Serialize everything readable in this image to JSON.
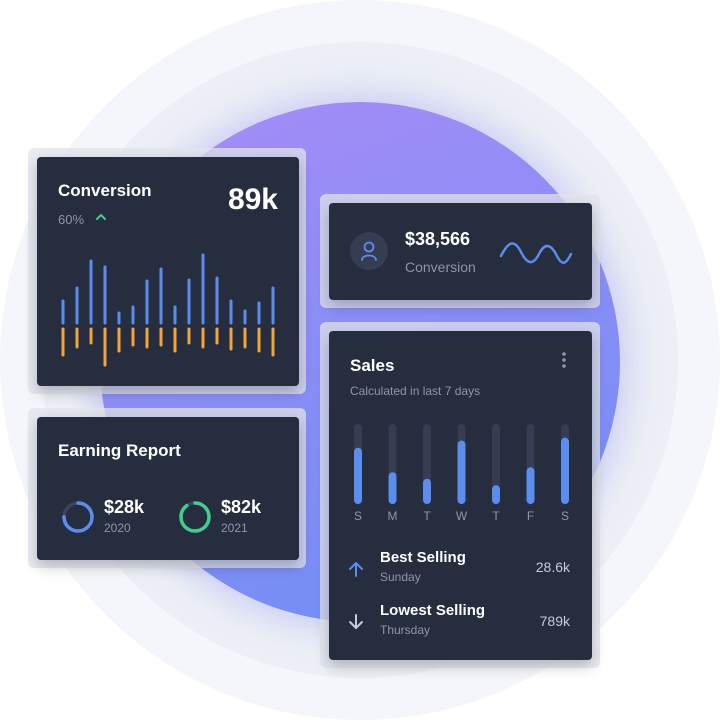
{
  "conversion_card": {
    "title": "Conversion",
    "value": "89k",
    "percent": "60%",
    "trend_icon": "chevron-up-icon",
    "colors": {
      "up": "#5b8def",
      "down": "#f3a43b",
      "trend": "#3fcf8e"
    },
    "bars": [
      {
        "up": 22,
        "down": 26
      },
      {
        "up": 35,
        "down": 18
      },
      {
        "up": 62,
        "down": 14
      },
      {
        "up": 56,
        "down": 36
      },
      {
        "up": 10,
        "down": 22
      },
      {
        "up": 16,
        "down": 16
      },
      {
        "up": 42,
        "down": 18
      },
      {
        "up": 54,
        "down": 16
      },
      {
        "up": 16,
        "down": 22
      },
      {
        "up": 43,
        "down": 14
      },
      {
        "up": 68,
        "down": 18
      },
      {
        "up": 45,
        "down": 14
      },
      {
        "up": 22,
        "down": 20
      },
      {
        "up": 12,
        "down": 18
      },
      {
        "up": 20,
        "down": 22
      },
      {
        "up": 35,
        "down": 26
      }
    ]
  },
  "earning_card": {
    "title": "Earning Report",
    "items": [
      {
        "amount": "$28k",
        "year": "2020",
        "color": "#5b8def",
        "fraction": 0.75
      },
      {
        "amount": "$82k",
        "year": "2021",
        "color": "#3fcf8e",
        "fraction": 0.9
      }
    ]
  },
  "stat_card": {
    "amount": "$38,566",
    "label": "Conversion",
    "icon": "user-icon",
    "wave_color": "#5b8def"
  },
  "sales_card": {
    "title": "Sales",
    "subtitle": "Calculated in last 7 days",
    "menu_icon": "more-vertical-icon",
    "bar_color": "#5b8def",
    "track_color": "#343d52",
    "days": [
      {
        "label": "S",
        "value": 0.67
      },
      {
        "label": "M",
        "value": 0.33
      },
      {
        "label": "T",
        "value": 0.24
      },
      {
        "label": "W",
        "value": 0.77
      },
      {
        "label": "T",
        "value": 0.15
      },
      {
        "label": "F",
        "value": 0.4
      },
      {
        "label": "S",
        "value": 0.81
      }
    ],
    "best": {
      "label": "Best Selling",
      "day": "Sunday",
      "value": "28.6k",
      "icon": "arrow-up-icon"
    },
    "lowest": {
      "label": "Lowest Selling",
      "day": "Thursday",
      "value": "789k",
      "icon": "arrow-down-icon"
    }
  }
}
